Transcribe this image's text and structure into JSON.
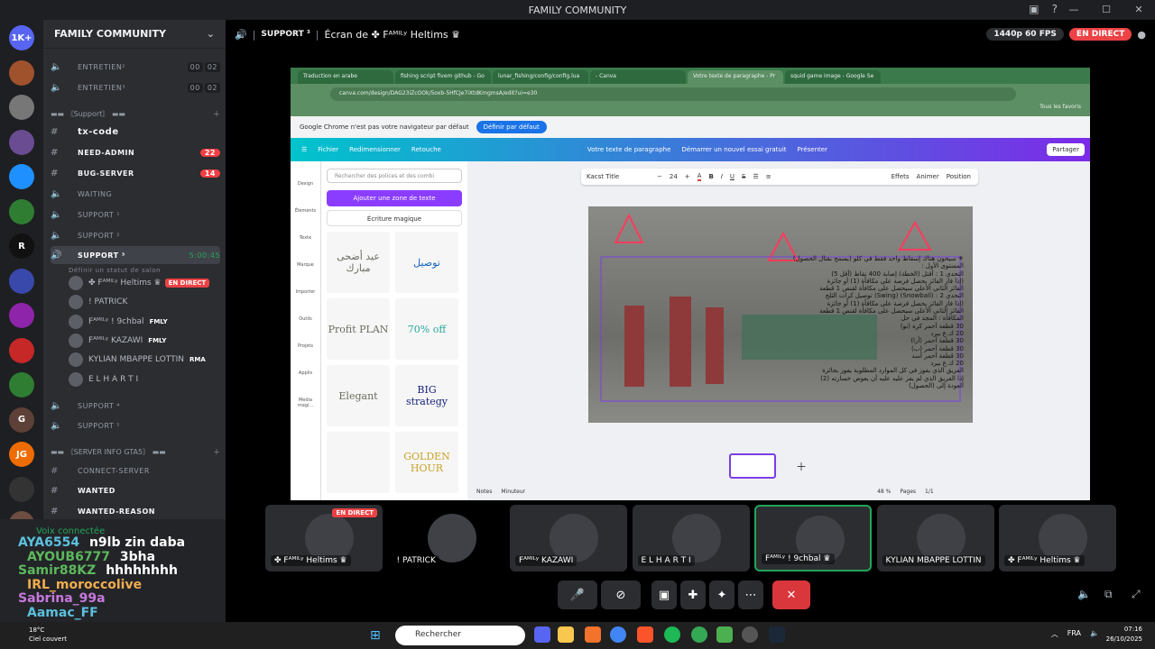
{
  "window": {
    "title": "FAMILY COMMUNITY",
    "controls": [
      "—",
      "☐",
      "✕"
    ]
  },
  "server": {
    "name": "FAMILY COMMUNITY"
  },
  "servers": [
    {
      "label": "1K+",
      "color": "#5865f2",
      "badge": "1K+"
    },
    {
      "label": "",
      "color": "#a0522d",
      "badge": "1"
    },
    {
      "label": "",
      "color": "#777",
      "badge": "6"
    },
    {
      "label": "",
      "color": "#6a4c93",
      "badge": "1"
    },
    {
      "label": "",
      "color": "#1e90ff",
      "badge": ""
    },
    {
      "label": "",
      "color": "#2e7d32",
      "badge": "3"
    },
    {
      "label": "R",
      "color": "#111",
      "badge": ""
    },
    {
      "label": "",
      "color": "#3949ab",
      "badge": "1"
    },
    {
      "label": "",
      "color": "#8e24aa",
      "badge": "4"
    },
    {
      "label": "",
      "color": "#c62828",
      "badge": "5"
    },
    {
      "label": "",
      "color": "#2e7d32",
      "badge": "3"
    },
    {
      "label": "G",
      "color": "#5d4037",
      "badge": "1"
    },
    {
      "label": "JG",
      "color": "#ef6c00",
      "badge": "7"
    },
    {
      "label": "",
      "color": "#333",
      "badge": ""
    },
    {
      "label": "",
      "color": "#6d4c41",
      "badge": "23"
    },
    {
      "label": "",
      "color": "#555",
      "badge": "6"
    },
    {
      "label": "NOUVEAU",
      "color": "#c62828",
      "badge": ""
    }
  ],
  "channels": {
    "entretien2": "ENTRETIEN",
    "entretien2_sup": "²",
    "entretien3": "ENTRETIEN",
    "entretien3_sup": "³",
    "pill_a": "00",
    "pill_b": "02",
    "pill_c": "00",
    "pill_d": "02",
    "cat_support": "▬▬ 〘Support〙 ▬▬",
    "txcode": "tx-code",
    "needadmin": "NEED-ADMIN",
    "needadmin_count": "22",
    "bugserver": "BUG-SERVER",
    "bugserver_count": "14",
    "waiting": "WAITING",
    "support1": "SUPPORT ¹",
    "support2": "SUPPORT ²",
    "support3": "SUPPORT ³",
    "support3_time": "5:00:45",
    "status": "Définir un statut de salon",
    "support4": "SUPPORT ⁴",
    "support5": "SUPPORT ⁵",
    "cat_gta": "▬▬ 〘SERVER INFO GTA5〙 ▬▬",
    "connect": "CONNECT-SERVER",
    "wanted": "WANTED",
    "wantedreason": "WANTED-REASON"
  },
  "voice_users": [
    {
      "name": "✤ Fᴬᴹᴵᴸʸ Heltims ♛",
      "live": "EN DIRECT",
      "tag": ""
    },
    {
      "name": "! PATRICK",
      "live": "",
      "tag": ""
    },
    {
      "name": "Fᴬᴹᴵᴸʸ ! 9chbal",
      "live": "",
      "tag": "FMLY"
    },
    {
      "name": "Fᴬᴹᴵᴸʸ KAZAWI",
      "live": "",
      "tag": "FMLY"
    },
    {
      "name": "KYLIAN MBAPPE LOTTIN",
      "live": "",
      "tag": "RMA"
    },
    {
      "name": "E L H A R T I",
      "live": "",
      "tag": ""
    }
  ],
  "voice_panel": {
    "connected": "Voix connectée",
    "overlay": [
      {
        "name": "AYA6554",
        "color": "#5bc0de",
        "extra": "n9lb zin daba"
      },
      {
        "name": "AYOUB6777",
        "color": "#5cb85c",
        "extra": "3bha"
      },
      {
        "name": "Samir88KZ",
        "color": "#5cb85c",
        "extra": "hhhhhhhh"
      },
      {
        "name": "IRL_moroccolive",
        "color": "#f0ad4e",
        "extra": ""
      },
      {
        "name": "Sabrina_99a",
        "color": "#c678dd",
        "extra": ""
      },
      {
        "name": "Aamac_FF",
        "color": "#5bc0de",
        "extra": ""
      }
    ]
  },
  "stage": {
    "channel": "SUPPORT ³",
    "screen_title": "Écran de ✤ Fᴬᴹᴵᴸʸ Heltims ♛",
    "quality": "1440p 60 FPS",
    "live": "EN DIRECT"
  },
  "browser": {
    "tabs": [
      "Traduction en arabe",
      "fishing script fivem github - Go",
      "lunar_fishing/config/config.lua",
      "- Canva",
      "Votre texte de paragraphe - Pr",
      "squid game image - Google Se"
    ],
    "url": "canva.com/design/DAG23iZcOOk/5oxb-5HfCJe7iXtdKmgmsA/edit?ui=e30",
    "bookmarks": "Tous les favoris",
    "infobar": "Google Chrome n'est pas votre navigateur par défaut",
    "infobar_btn": "Définir par défaut"
  },
  "canva": {
    "menu": [
      "Fichier",
      "Redimensionner",
      "Retouche"
    ],
    "doc_title": "Votre texte de paragraphe",
    "trial": "Démarrer un nouvel essai gratuit",
    "present": "Présenter",
    "share": "Partager",
    "search_placeholder": "Rechercher des polices et des combi",
    "add_text": "Ajouter une zone de texte",
    "magic": "Écriture magique",
    "rail": [
      "Design",
      "Éléments",
      "Texte",
      "Marque",
      "Importer",
      "Outils",
      "Projets",
      "Applis",
      "Media magi..."
    ],
    "thumbs": [
      "عيد أضحى مبارك",
      "توصيل",
      "Profit PLAN",
      "70% off",
      "Elegant",
      "BIG strategy",
      "",
      "GOLDEN HOUR"
    ],
    "font": "Kacst Title",
    "font_size": "24",
    "effects": "Effets",
    "animate": "Animer",
    "position": "Position",
    "notes": "Notes",
    "timer": "Minuteur",
    "zoom": "48 %",
    "pages": "Pages",
    "page_count": "1/1",
    "slide_lines": [
      "⚜ سيحون هناك إسقاط واحد فقط في كلو (يسمح بقتال الحصول)",
      "المستوى الأول :",
      "التحدي 1 : أقتل (الخطة) إصابة 400 نقاط (أقل 5)",
      "(إذا فاز الفائز يحصل فرصة على مكافأة (1) أو جائزة",
      "الفائز الثاني الأعلى سيحصل على مكافأة لقنص 1 قطعة",
      "التحدي 2 : (Snowball) (Swing) توصيل كرات الثلج",
      "(إذا فاز الفائز يحصل فرصة على مكافأة (1) أو جائزة",
      "الفائز الثاني الأعلى سيحصل على مكافأة لقنص 1 قطعة",
      "المكافأة : المجد في حل",
      "30 قطعة أحمر كرة (نو)",
      "20 ك.ع بيرد",
      "30 قطعة أحمر (أرا)",
      "30 قطعة أحمر (ب)",
      "30 قطعة أحمر أسد",
      "20 ك.ع بيرد",
      "الفريق الذي يفوز في كل الموارد المطلوبة يفوز بجائزة",
      "إذا الفريق الذي لم يفز عليه عليه أن يعوض خسارته (2)",
      "العودة إلى (الحصول)"
    ]
  },
  "tiles": [
    {
      "name": "✤ Fᴬᴹᴵᴸʸ Heltims ♛",
      "live": "EN DIRECT"
    },
    {
      "name": "! PATRICK",
      "live": ""
    },
    {
      "name": "Fᴬᴹᴵᴸʸ KAZAWI",
      "live": ""
    },
    {
      "name": "E L H A R T I",
      "live": ""
    },
    {
      "name": "Fᴬᴹᴵᴸʸ ! 9chbal ♛",
      "live": ""
    },
    {
      "name": "KYLIAN MBAPPE LOTTIN",
      "live": ""
    },
    {
      "name": "✤ Fᴬᴹᴵᴸʸ Heltims ♛",
      "live": ""
    }
  ],
  "taskbar": {
    "temp": "18°C",
    "weather": "Ciel couvert",
    "search": "Rechercher",
    "lang": "FRA",
    "time": "07:16",
    "date": "26/10/2025"
  }
}
